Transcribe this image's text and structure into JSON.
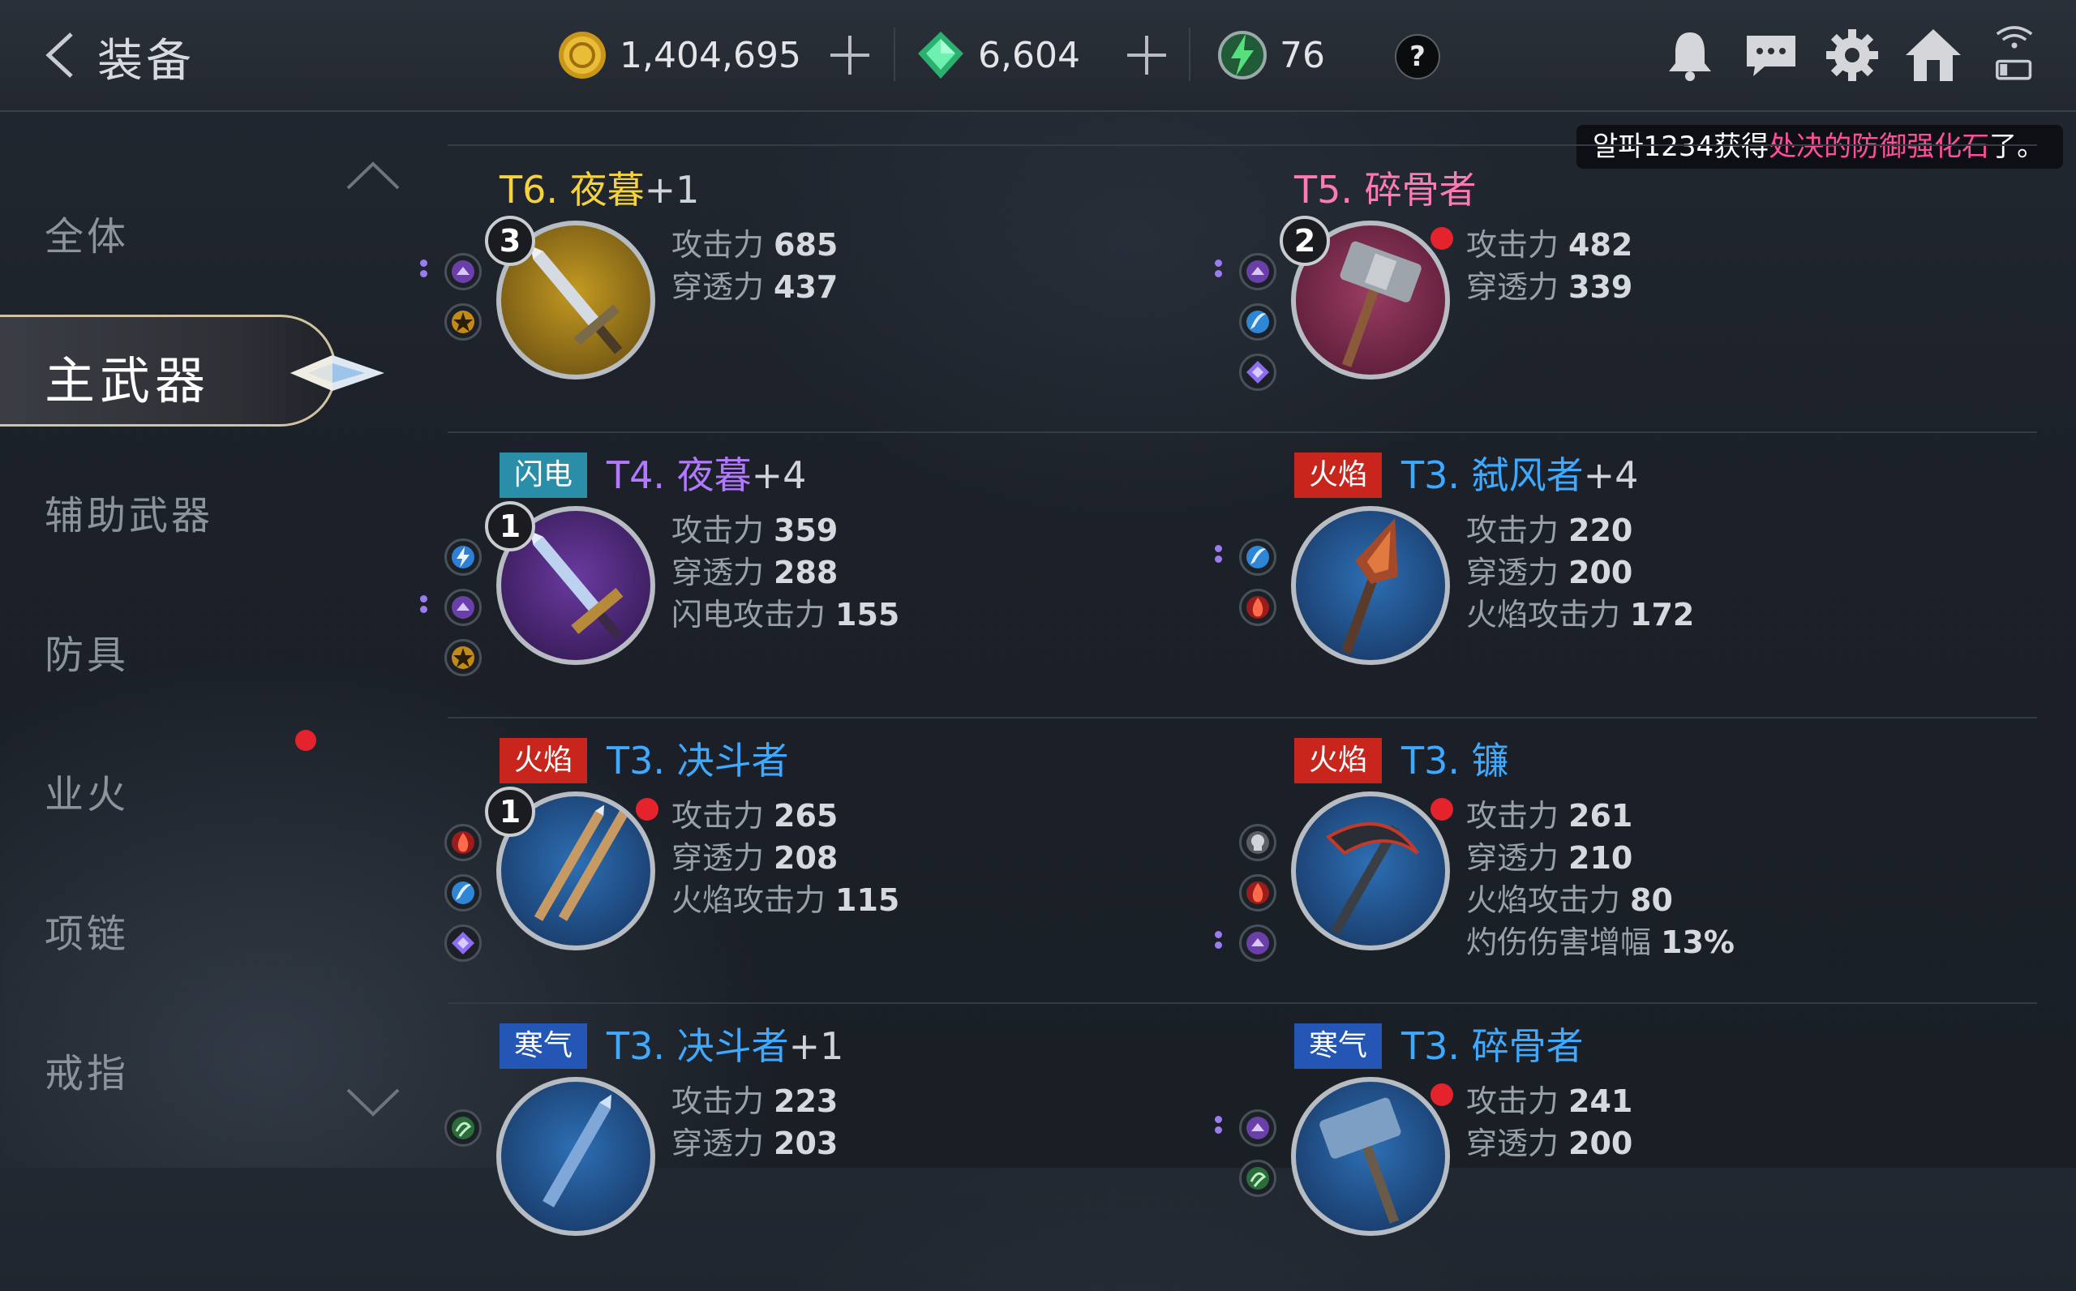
{
  "header": {
    "title": "装备",
    "gold": "1,404,695",
    "gems": "6,604",
    "stamina": "76",
    "help_label": "?"
  },
  "notification": {
    "prefix": "알파1234获得",
    "highlight": "处决的防御强化石",
    "suffix": "了。"
  },
  "sidebar": {
    "items": [
      {
        "label": "全体"
      },
      {
        "label": "主武器"
      },
      {
        "label": "辅助武器"
      },
      {
        "label": "防具"
      },
      {
        "label": "业火"
      },
      {
        "label": "项链"
      },
      {
        "label": "戒指"
      }
    ]
  },
  "equipment": [
    {
      "tier": "T6. 夜暮",
      "enhance": "+1",
      "name_color": "#f4d33c",
      "level": "3",
      "tag": "",
      "red_dot": false,
      "stats": [
        {
          "label": "攻击力",
          "value": "685"
        },
        {
          "label": "穿透力",
          "value": "437"
        }
      ],
      "sockets": [
        "purple-socket-icon",
        "gold-star-socket-icon"
      ],
      "pip_socket": 0
    },
    {
      "tier": "T5. 碎骨者",
      "enhance": "",
      "name_color": "#ff7ab3",
      "level": "2",
      "tag": "",
      "red_dot": true,
      "stats": [
        {
          "label": "攻击力",
          "value": "482"
        },
        {
          "label": "穿透力",
          "value": "339"
        }
      ],
      "sockets": [
        "purple-socket-icon",
        "blue-feather-socket-icon",
        "violet-gem-socket-icon"
      ],
      "pip_socket": 0
    },
    {
      "tier": "T4. 夜暮",
      "enhance": "+4",
      "name_color": "#b279ff",
      "level": "1",
      "tag": "闪电",
      "red_dot": false,
      "stats": [
        {
          "label": "攻击力",
          "value": "359"
        },
        {
          "label": "穿透力",
          "value": "288"
        },
        {
          "label": "闪电攻击力",
          "value": "155"
        }
      ],
      "sockets": [
        "lightning-socket-icon",
        "purple-socket-icon",
        "gold-star-socket-icon"
      ],
      "pip_socket": 1
    },
    {
      "tier": "T3. 弑风者",
      "enhance": "+4",
      "name_color": "#3fa9ff",
      "level": "",
      "tag": "火焰",
      "red_dot": false,
      "stats": [
        {
          "label": "攻击力",
          "value": "220"
        },
        {
          "label": "穿透力",
          "value": "200"
        },
        {
          "label": "火焰攻击力",
          "value": "172"
        }
      ],
      "sockets": [
        "blue-feather-socket-icon",
        "fire-socket-icon"
      ],
      "pip_socket": 0
    },
    {
      "tier": "T3. 决斗者",
      "enhance": "",
      "name_color": "#3fa9ff",
      "level": "1",
      "tag": "火焰",
      "red_dot": true,
      "stats": [
        {
          "label": "攻击力",
          "value": "265"
        },
        {
          "label": "穿透力",
          "value": "208"
        },
        {
          "label": "火焰攻击力",
          "value": "115"
        }
      ],
      "sockets": [
        "fire-socket-icon",
        "blue-feather-socket-icon",
        "violet-gem-socket-icon"
      ],
      "pip_socket": -1
    },
    {
      "tier": "T3. 镰",
      "enhance": "",
      "name_color": "#3fa9ff",
      "level": "",
      "tag": "火焰",
      "red_dot": true,
      "stats": [
        {
          "label": "攻击力",
          "value": "261"
        },
        {
          "label": "穿透力",
          "value": "210"
        },
        {
          "label": "火焰攻击力",
          "value": "80"
        },
        {
          "label": "灼伤伤害增幅",
          "value": "13%"
        }
      ],
      "sockets": [
        "gray-skull-socket-icon",
        "fire-socket-icon",
        "purple-socket-icon"
      ],
      "pip_socket": 2
    },
    {
      "tier": "T3. 决斗者",
      "enhance": "+1",
      "name_color": "#3fa9ff",
      "level": "",
      "tag": "寒气",
      "red_dot": false,
      "stats": [
        {
          "label": "攻击力",
          "value": "223"
        },
        {
          "label": "穿透力",
          "value": "203"
        }
      ],
      "sockets": [
        "green-swirl-socket-icon"
      ],
      "pip_socket": -1
    },
    {
      "tier": "T3. 碎骨者",
      "enhance": "",
      "name_color": "#3fa9ff",
      "level": "",
      "tag": "寒气",
      "red_dot": true,
      "stats": [
        {
          "label": "攻击力",
          "value": "241"
        },
        {
          "label": "穿透力",
          "value": "200"
        }
      ],
      "sockets": [
        "purple-socket-icon",
        "green-swirl-socket-icon"
      ],
      "pip_socket": 0
    }
  ],
  "colors": {
    "gold_accent": "#f4d33c",
    "pink_accent": "#ff7ab3",
    "blue_accent": "#3fa9ff",
    "purple_accent": "#b279ff",
    "red_dot": "#e5232d"
  }
}
